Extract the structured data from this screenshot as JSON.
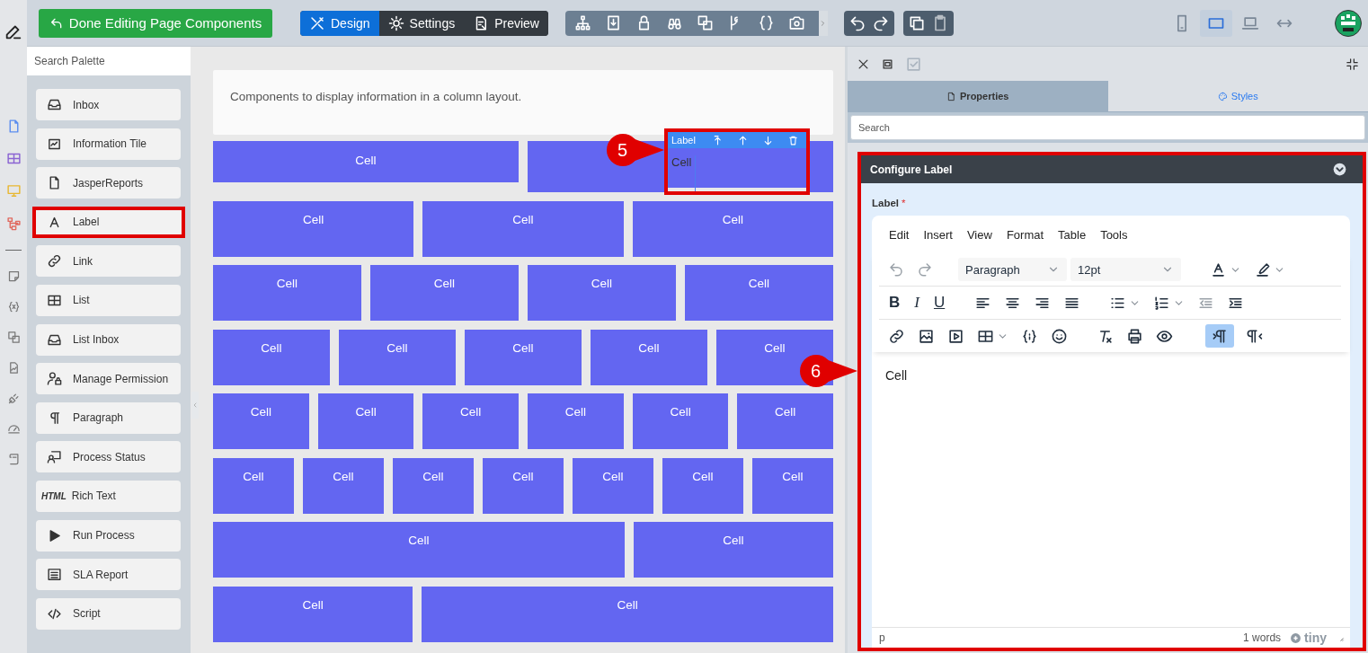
{
  "toolbar": {
    "done_button": "Done Editing Page Components",
    "modes": [
      {
        "label": "Design",
        "selected": true
      },
      {
        "label": "Settings",
        "selected": false
      },
      {
        "label": "Preview",
        "selected": false
      }
    ],
    "devices": [
      {
        "selected": false
      },
      {
        "selected": true
      },
      {
        "selected": false
      },
      {
        "selected": false
      }
    ]
  },
  "palette": {
    "search": {
      "placeholder": "Search Palette"
    },
    "items": [
      {
        "label": "Inbox",
        "highlighted": false
      },
      {
        "label": "Information Tile",
        "highlighted": false
      },
      {
        "label": "JasperReports",
        "highlighted": false
      },
      {
        "label": "Label",
        "highlighted": true
      },
      {
        "label": "Link",
        "highlighted": false
      },
      {
        "label": "List",
        "highlighted": false
      },
      {
        "label": "List Inbox",
        "highlighted": false
      },
      {
        "label": "Manage Permission",
        "highlighted": false
      },
      {
        "label": "Paragraph",
        "highlighted": false
      },
      {
        "label": "Process Status",
        "highlighted": false
      },
      {
        "label": "Rich Text",
        "icon_text": "HTML",
        "highlighted": false
      },
      {
        "label": "Run Process",
        "highlighted": false
      },
      {
        "label": "SLA Report",
        "highlighted": false
      },
      {
        "label": "Script",
        "highlighted": false
      }
    ]
  },
  "canvas": {
    "description": "Components to display information in a column layout.",
    "layout_rows": [
      {
        "cells": [
          {
            "kind": "cell",
            "text": "Cell"
          },
          {
            "kind": "host",
            "label_component": {
              "title": "Label",
              "text": "Cell",
              "highlighted": true
            }
          }
        ]
      },
      {
        "cells": [
          {
            "kind": "cell",
            "text": "Cell"
          },
          {
            "kind": "cell",
            "text": "Cell"
          },
          {
            "kind": "cell",
            "text": "Cell"
          }
        ]
      },
      {
        "cells": [
          {
            "kind": "cell",
            "text": "Cell"
          },
          {
            "kind": "cell",
            "text": "Cell"
          },
          {
            "kind": "cell",
            "text": "Cell"
          },
          {
            "kind": "cell",
            "text": "Cell"
          }
        ]
      },
      {
        "cells": [
          {
            "kind": "cell",
            "text": "Cell"
          },
          {
            "kind": "cell",
            "text": "Cell"
          },
          {
            "kind": "cell",
            "text": "Cell"
          },
          {
            "kind": "cell",
            "text": "Cell"
          },
          {
            "kind": "cell",
            "text": "Cell"
          }
        ]
      },
      {
        "cells": [
          {
            "kind": "cell",
            "text": "Cell"
          },
          {
            "kind": "cell",
            "text": "Cell"
          },
          {
            "kind": "cell",
            "text": "Cell"
          },
          {
            "kind": "cell",
            "text": "Cell"
          },
          {
            "kind": "cell",
            "text": "Cell"
          },
          {
            "kind": "cell",
            "text": "Cell"
          }
        ]
      },
      {
        "cells": [
          {
            "kind": "cell",
            "text": "Cell"
          },
          {
            "kind": "cell",
            "text": "Cell"
          },
          {
            "kind": "cell",
            "text": "Cell"
          },
          {
            "kind": "cell",
            "text": "Cell"
          },
          {
            "kind": "cell",
            "text": "Cell"
          },
          {
            "kind": "cell",
            "text": "Cell"
          },
          {
            "kind": "cell",
            "text": "Cell"
          }
        ]
      },
      {
        "cells": [
          {
            "kind": "wide",
            "text": "Cell"
          },
          {
            "kind": "cell",
            "text": "Cell"
          }
        ]
      },
      {
        "cells": [
          {
            "kind": "cell",
            "text": "Cell"
          },
          {
            "kind": "wide",
            "text": "Cell"
          }
        ]
      }
    ]
  },
  "annotations": [
    {
      "text": "5"
    },
    {
      "text": "6"
    }
  ],
  "properties": {
    "tabs": [
      {
        "label": "Properties",
        "selected": true
      },
      {
        "label": "Styles",
        "selected": false
      }
    ],
    "search": {
      "placeholder": "Search"
    },
    "section": {
      "title": "Configure Label",
      "highlighted": true,
      "expanded": true
    },
    "field": {
      "label": "Label",
      "required_mark": "*"
    },
    "editor": {
      "menu": [
        "Edit",
        "Insert",
        "View",
        "Format",
        "Table",
        "Tools"
      ],
      "block_format": "Paragraph",
      "font_size": "12pt",
      "format_buttons": [
        "B",
        "I",
        "U"
      ],
      "ltr_selected": true,
      "rtl_selected": false,
      "content": "Cell",
      "path": "p",
      "word_count": "1 words",
      "brand": "tiny"
    }
  }
}
